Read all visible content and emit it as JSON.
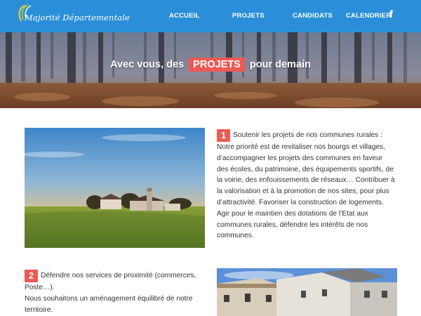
{
  "nav": {
    "logo_text": "Majorité Départementale",
    "items": [
      "ACCUEIL",
      "PROJETS",
      "CANDIDATS",
      "CALENDRIER"
    ],
    "facebook_glyph": "f",
    "background": "#2a8fd8"
  },
  "hero": {
    "title_before": "Avec vous, des",
    "title_highlight": "PROJETS",
    "title_after": "pour demain",
    "accent": "#ec5a54"
  },
  "projects": [
    {
      "number": "1",
      "heading": "Soutenir les projets de nos communes rurales :",
      "body": "Notre priorité est de revitaliser nos bourgs et villages, d’accompagner les projets des communes en faveur des écoles, du patrimoine, des équipements sportifs, de la voirie, des enfouissements de réseaux… Contribuer à la valorisation et à la promotion de nos sites, pour plus d’attractivité. Favoriser la construction de logements. Agir pour le maintien des dotations de l’Etat aux communes rurales, défendre les intérêts de nos communes."
    },
    {
      "number": "2",
      "heading": "Défendre nos services de proximité (commerces, Poste…).",
      "body": "Nous souhaitons un aménagement équilibré de notre territoire."
    }
  ]
}
